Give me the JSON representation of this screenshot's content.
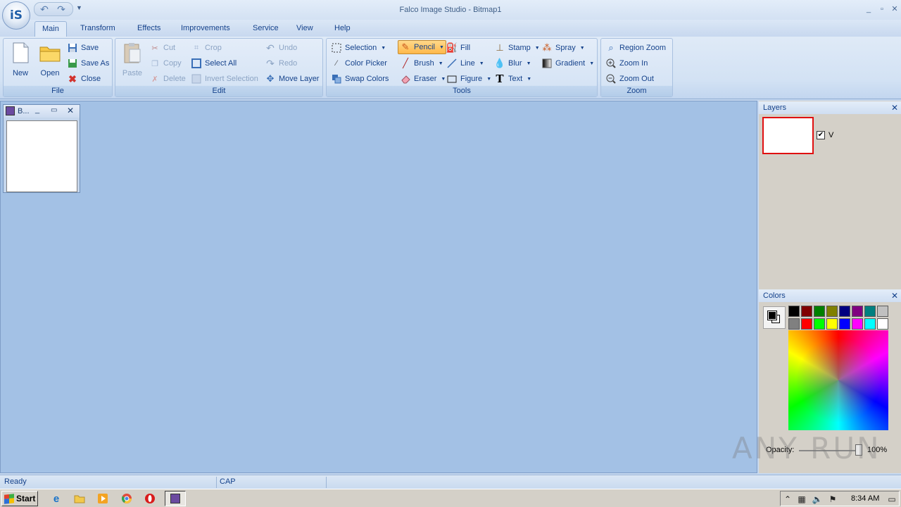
{
  "app": {
    "orb_label": "iS",
    "window_title": "Falco Image Studio - Bitmap1"
  },
  "tabs": [
    "Main",
    "Transform",
    "Effects",
    "Improvements",
    "Service",
    "View",
    "Help"
  ],
  "ribbon": {
    "file": {
      "label": "File",
      "new": "New",
      "open": "Open",
      "save": "Save",
      "save_as": "Save As",
      "close": "Close"
    },
    "edit": {
      "label": "Edit",
      "paste": "Paste",
      "cut": "Cut",
      "copy": "Copy",
      "delete": "Delete",
      "crop": "Crop",
      "select_all": "Select All",
      "invert_selection": "Invert Selection",
      "undo": "Undo",
      "redo": "Redo",
      "move_layer": "Move Layer"
    },
    "tools": {
      "label": "Tools",
      "selection": "Selection",
      "color_picker": "Color Picker",
      "swap_colors": "Swap Colors",
      "pencil": "Pencil",
      "brush": "Brush",
      "eraser": "Eraser",
      "fill": "Fill",
      "line": "Line",
      "figure": "Figure",
      "stamp": "Stamp",
      "blur": "Blur",
      "text": "Text",
      "spray": "Spray",
      "gradient": "Gradient"
    },
    "zoom": {
      "label": "Zoom",
      "region_zoom": "Region Zoom",
      "zoom_in": "Zoom In",
      "zoom_out": "Zoom Out"
    }
  },
  "document": {
    "title": "B..."
  },
  "layers_panel": {
    "title": "Layers",
    "layer_name": "V",
    "visible": true
  },
  "colors_panel": {
    "title": "Colors",
    "palette": [
      "#000000",
      "#800000",
      "#008000",
      "#808000",
      "#000080",
      "#800080",
      "#008080",
      "#c0c0c0",
      "#808080",
      "#ff0000",
      "#00ff00",
      "#ffff00",
      "#0000ff",
      "#ff00ff",
      "#00ffff",
      "#ffffff"
    ],
    "foreground": "#000000",
    "background": "#ffffff",
    "opacity_label": "Opacity:",
    "opacity_value": "100%"
  },
  "statusbar": {
    "status": "Ready",
    "caps": "CAP"
  },
  "taskbar": {
    "start_label": "Start",
    "clock": "8:34 AM"
  },
  "watermark": "ANY RUN"
}
